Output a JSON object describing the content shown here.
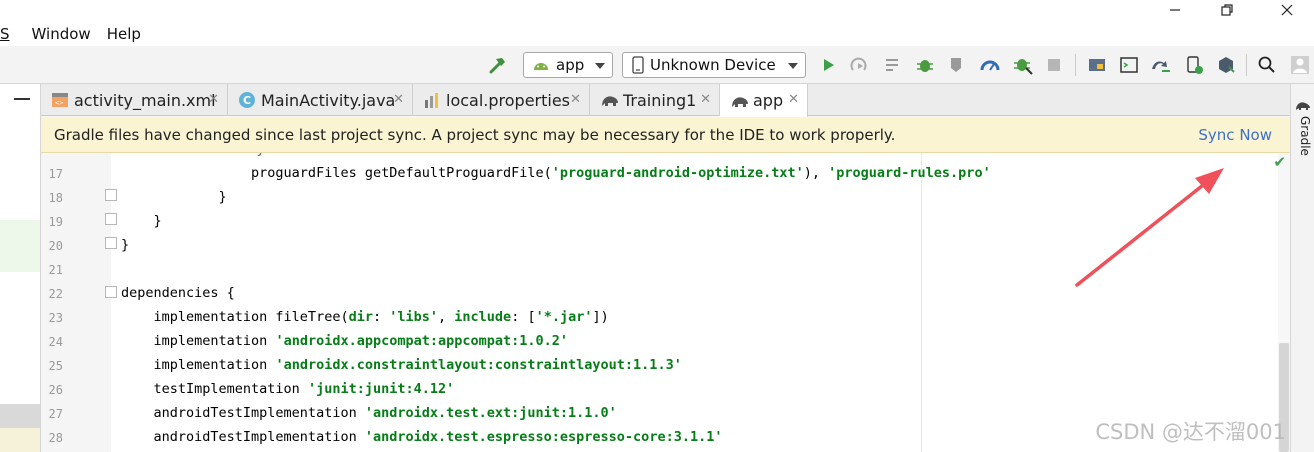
{
  "menu": {
    "items": [
      "S",
      "Window",
      "Help"
    ]
  },
  "toolbar": {
    "module_combo": "app",
    "device_combo": "Unknown Device"
  },
  "tabs": [
    {
      "label": "activity_main.xml",
      "icon": "xml-file-icon"
    },
    {
      "label": "MainActivity.java",
      "icon": "java-class-icon"
    },
    {
      "label": "local.properties",
      "icon": "properties-file-icon"
    },
    {
      "label": "Training1",
      "icon": "gradle-elephant-icon"
    },
    {
      "label": "app",
      "icon": "gradle-elephant-icon",
      "active": true
    }
  ],
  "banner": {
    "message": "Gradle files have changed since last project sync. A project sync may be necessary for the IDE to work properly.",
    "action": "Sync Now"
  },
  "right_panel": {
    "label": "Gradle"
  },
  "editor": {
    "lines": [
      {
        "no": "17",
        "segments": [
          {
            "t": "                proguardFiles getDefaultProguardFile("
          },
          {
            "t": "'proguard-android-optimize.txt'",
            "c": "str"
          },
          {
            "t": "), "
          },
          {
            "t": "'proguard-rules.pro'",
            "c": "str"
          }
        ]
      },
      {
        "no": "18",
        "segments": [
          {
            "t": "            }"
          }
        ]
      },
      {
        "no": "19",
        "segments": [
          {
            "t": "    }"
          }
        ]
      },
      {
        "no": "20",
        "segments": [
          {
            "t": "}"
          }
        ]
      },
      {
        "no": "21",
        "segments": [
          {
            "t": ""
          }
        ]
      },
      {
        "no": "22",
        "segments": [
          {
            "t": "dependencies {"
          }
        ]
      },
      {
        "no": "23",
        "segments": [
          {
            "t": "    implementation fileTree("
          },
          {
            "t": "dir",
            "c": "kw"
          },
          {
            "t": ": "
          },
          {
            "t": "'libs'",
            "c": "str"
          },
          {
            "t": ", "
          },
          {
            "t": "include",
            "c": "kw"
          },
          {
            "t": ": ["
          },
          {
            "t": "'*.jar'",
            "c": "str"
          },
          {
            "t": "])"
          }
        ]
      },
      {
        "no": "24",
        "segments": [
          {
            "t": "    implementation "
          },
          {
            "t": "'androidx.appcompat:appcompat:1.0.2'",
            "c": "str"
          }
        ]
      },
      {
        "no": "25",
        "segments": [
          {
            "t": "    implementation "
          },
          {
            "t": "'androidx.constraintlayout:constraintlayout:1.1.3'",
            "c": "str"
          }
        ]
      },
      {
        "no": "26",
        "segments": [
          {
            "t": "    testImplementation "
          },
          {
            "t": "'junit:junit:4.12'",
            "c": "str"
          }
        ]
      },
      {
        "no": "27",
        "segments": [
          {
            "t": "    androidTestImplementation "
          },
          {
            "t": "'androidx.test.ext:junit:1.1.0'",
            "c": "str"
          }
        ]
      },
      {
        "no": "28",
        "segments": [
          {
            "t": "    androidTestImplementation "
          },
          {
            "t": "'androidx.test.espresso:espresso-core:3.1.1'",
            "c": "str"
          }
        ]
      }
    ]
  },
  "watermark": "CSDN @达不溜001",
  "colors": {
    "banner_bg": "#fbf4d3",
    "link": "#3d70c9",
    "string": "#067d17",
    "annotation_arrow": "#f0505a"
  }
}
